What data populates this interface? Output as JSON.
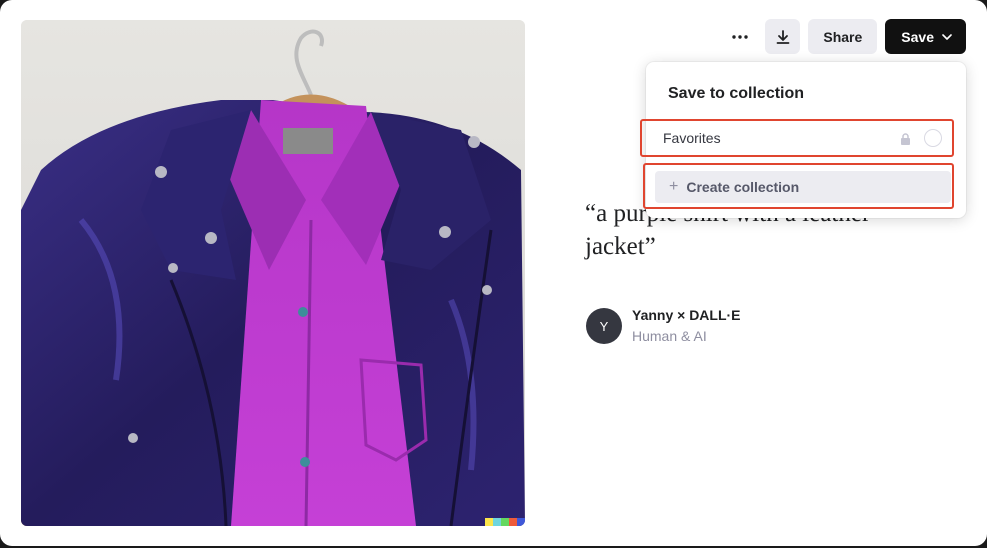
{
  "toolbar": {
    "more_icon": "more-horizontal-icon",
    "download_icon": "download-icon",
    "share_label": "Share",
    "save_label": "Save",
    "save_chevron_icon": "chevron-down-icon"
  },
  "prompt": "“a purple shirt with a leather jacket”",
  "author": {
    "initial": "Y",
    "name": "Yanny × DALL·E",
    "subtitle": "Human & AI"
  },
  "dropdown": {
    "title": "Save to collection",
    "collections": [
      {
        "label": "Favorites",
        "private_icon": "lock-icon",
        "selected": false
      }
    ],
    "create_label": "Create collection",
    "create_icon": "plus-icon"
  },
  "image": {
    "subject": "purple-leather-jacket-on-hanger",
    "signature_colors": [
      "#fbe54b",
      "#6fd6de",
      "#64d85f",
      "#ee5a3a",
      "#3f58d9"
    ]
  },
  "colors": {
    "accent_dark": "#111111",
    "highlight_outline": "#e0452f",
    "button_gray": "#ececf1"
  }
}
